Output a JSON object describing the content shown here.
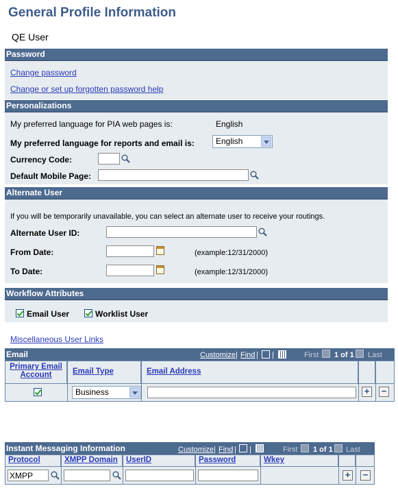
{
  "page": {
    "title": "General Profile Information",
    "user_name": "QE User"
  },
  "password_section": {
    "header": "Password",
    "change_password_link": "Change password",
    "forgot_help_link": "Change or set up forgotten password help"
  },
  "personalizations": {
    "header": "Personalizations",
    "pia_language_label": "My preferred language for PIA web pages is:",
    "pia_language_value": "English",
    "report_language_label": "My preferred language for reports and email is:",
    "report_language_value": "English",
    "currency_label": "Currency Code:",
    "currency_value": "",
    "mobile_page_label": "Default Mobile Page:",
    "mobile_page_value": ""
  },
  "alternate_user": {
    "header": "Alternate User",
    "intro": "If you will be temporarily unavailable, you can select an alternate user to receive your routings.",
    "id_label": "Alternate User ID:",
    "id_value": "",
    "from_label": "From Date:",
    "from_value": "",
    "from_example": "(example:12/31/2000)",
    "to_label": "To Date:",
    "to_value": "",
    "to_example": "(example:12/31/2000)"
  },
  "workflow": {
    "header": "Workflow Attributes",
    "email_user_label": "Email User",
    "email_user_checked": true,
    "worklist_user_label": "Worklist User",
    "worklist_user_checked": true
  },
  "misc_link": "Miscellaneous User Links",
  "email_grid": {
    "title": "Email",
    "customize": "Customize",
    "find": "Find",
    "first": "First",
    "range": "1 of 1",
    "last": "Last",
    "columns": [
      "Primary Email Account",
      "Email Type",
      "Email Address"
    ],
    "rows": [
      {
        "primary": true,
        "type": "Business",
        "address": ""
      }
    ]
  },
  "im_grid": {
    "title": "Instant Messaging Information",
    "customize": "Customize",
    "find": "Find",
    "first": "First",
    "range": "1 of 1",
    "last": "Last",
    "columns": [
      "Protocol",
      "XMPP Domain",
      "UserID",
      "Password",
      "Wkey"
    ],
    "rows": [
      {
        "protocol": "XMPP",
        "domain": "",
        "userid": "",
        "password": "",
        "wkey": ""
      }
    ]
  },
  "icons": {
    "lookup": "magnifier-icon",
    "calendar": "calendar-icon",
    "add": "plus",
    "delete": "minus"
  },
  "colors": {
    "header_bg": "#4d6a8f",
    "section_bg": "#e7ecf0",
    "title": "#3d5c8a",
    "link": "#2b3bb8"
  }
}
